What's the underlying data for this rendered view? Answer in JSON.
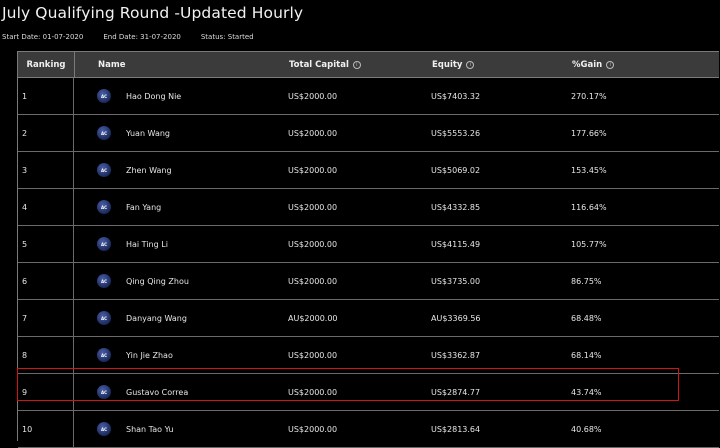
{
  "page": {
    "title": "July Qualifying Round -Updated Hourly",
    "start_date": "Start Date: 01-07-2020",
    "end_date": "End Date: 31-07-2020",
    "status": "Status: Started"
  },
  "table": {
    "headers": {
      "ranking": "Ranking",
      "name": "Name",
      "total_capital": "Total Capital",
      "equity": "Equity",
      "gain": "%Gain"
    },
    "info_glyph": "i",
    "logo_text": "AC",
    "rows": [
      {
        "rank": "1",
        "name": "Hao Dong Nie",
        "capital": "US$2000.00",
        "equity": "US$7403.32",
        "gain": "270.17%"
      },
      {
        "rank": "2",
        "name": "Yuan Wang",
        "capital": "US$2000.00",
        "equity": "US$5553.26",
        "gain": "177.66%"
      },
      {
        "rank": "3",
        "name": "Zhen Wang",
        "capital": "US$2000.00",
        "equity": "US$5069.02",
        "gain": "153.45%"
      },
      {
        "rank": "4",
        "name": "Fan Yang",
        "capital": "US$2000.00",
        "equity": "US$4332.85",
        "gain": "116.64%"
      },
      {
        "rank": "5",
        "name": "Hai Ting Li",
        "capital": "US$2000.00",
        "equity": "US$4115.49",
        "gain": "105.77%"
      },
      {
        "rank": "6",
        "name": "Qing Qing Zhou",
        "capital": "US$2000.00",
        "equity": "US$3735.00",
        "gain": "86.75%"
      },
      {
        "rank": "7",
        "name": "Danyang Wang",
        "capital": "AU$2000.00",
        "equity": "AU$3369.56",
        "gain": "68.48%"
      },
      {
        "rank": "8",
        "name": "Yin Jie Zhao",
        "capital": "US$2000.00",
        "equity": "US$3362.87",
        "gain": "68.14%"
      },
      {
        "rank": "9",
        "name": "Gustavo Correa",
        "capital": "US$2000.00",
        "equity": "US$2874.77",
        "gain": "43.74%"
      },
      {
        "rank": "10",
        "name": "Shan Tao Yu",
        "capital": "US$2000.00",
        "equity": "US$2813.64",
        "gain": "40.68%"
      }
    ]
  },
  "colors": {
    "background": "#000000",
    "header_bg": "#3b3b3b",
    "highlight": "#d21414",
    "logo": "#1b2a5c"
  },
  "highlighted_rank": "9"
}
